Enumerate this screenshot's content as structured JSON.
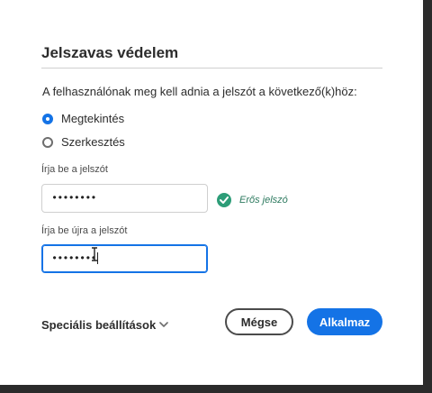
{
  "dialog": {
    "title": "Jelszavas védelem",
    "subtitle": "A felhasználónak meg kell adnia a jelszót a következő(k)höz:",
    "options": [
      {
        "label": "Megtekintés",
        "checked": true
      },
      {
        "label": "Szerkesztés",
        "checked": false
      }
    ],
    "password": {
      "label": "Írja be a jelszót",
      "value": "••••••••"
    },
    "strength": {
      "label": "Erős jelszó",
      "icon": "checkmark-circle-icon",
      "color": "#2d9d78"
    },
    "confirm": {
      "label": "Írja be újra a jelszót",
      "value": "••••••••"
    },
    "advanced_label": "Speciális beállítások",
    "cancel_label": "Mégse",
    "apply_label": "Alkalmaz",
    "accent_color": "#1473e6"
  }
}
